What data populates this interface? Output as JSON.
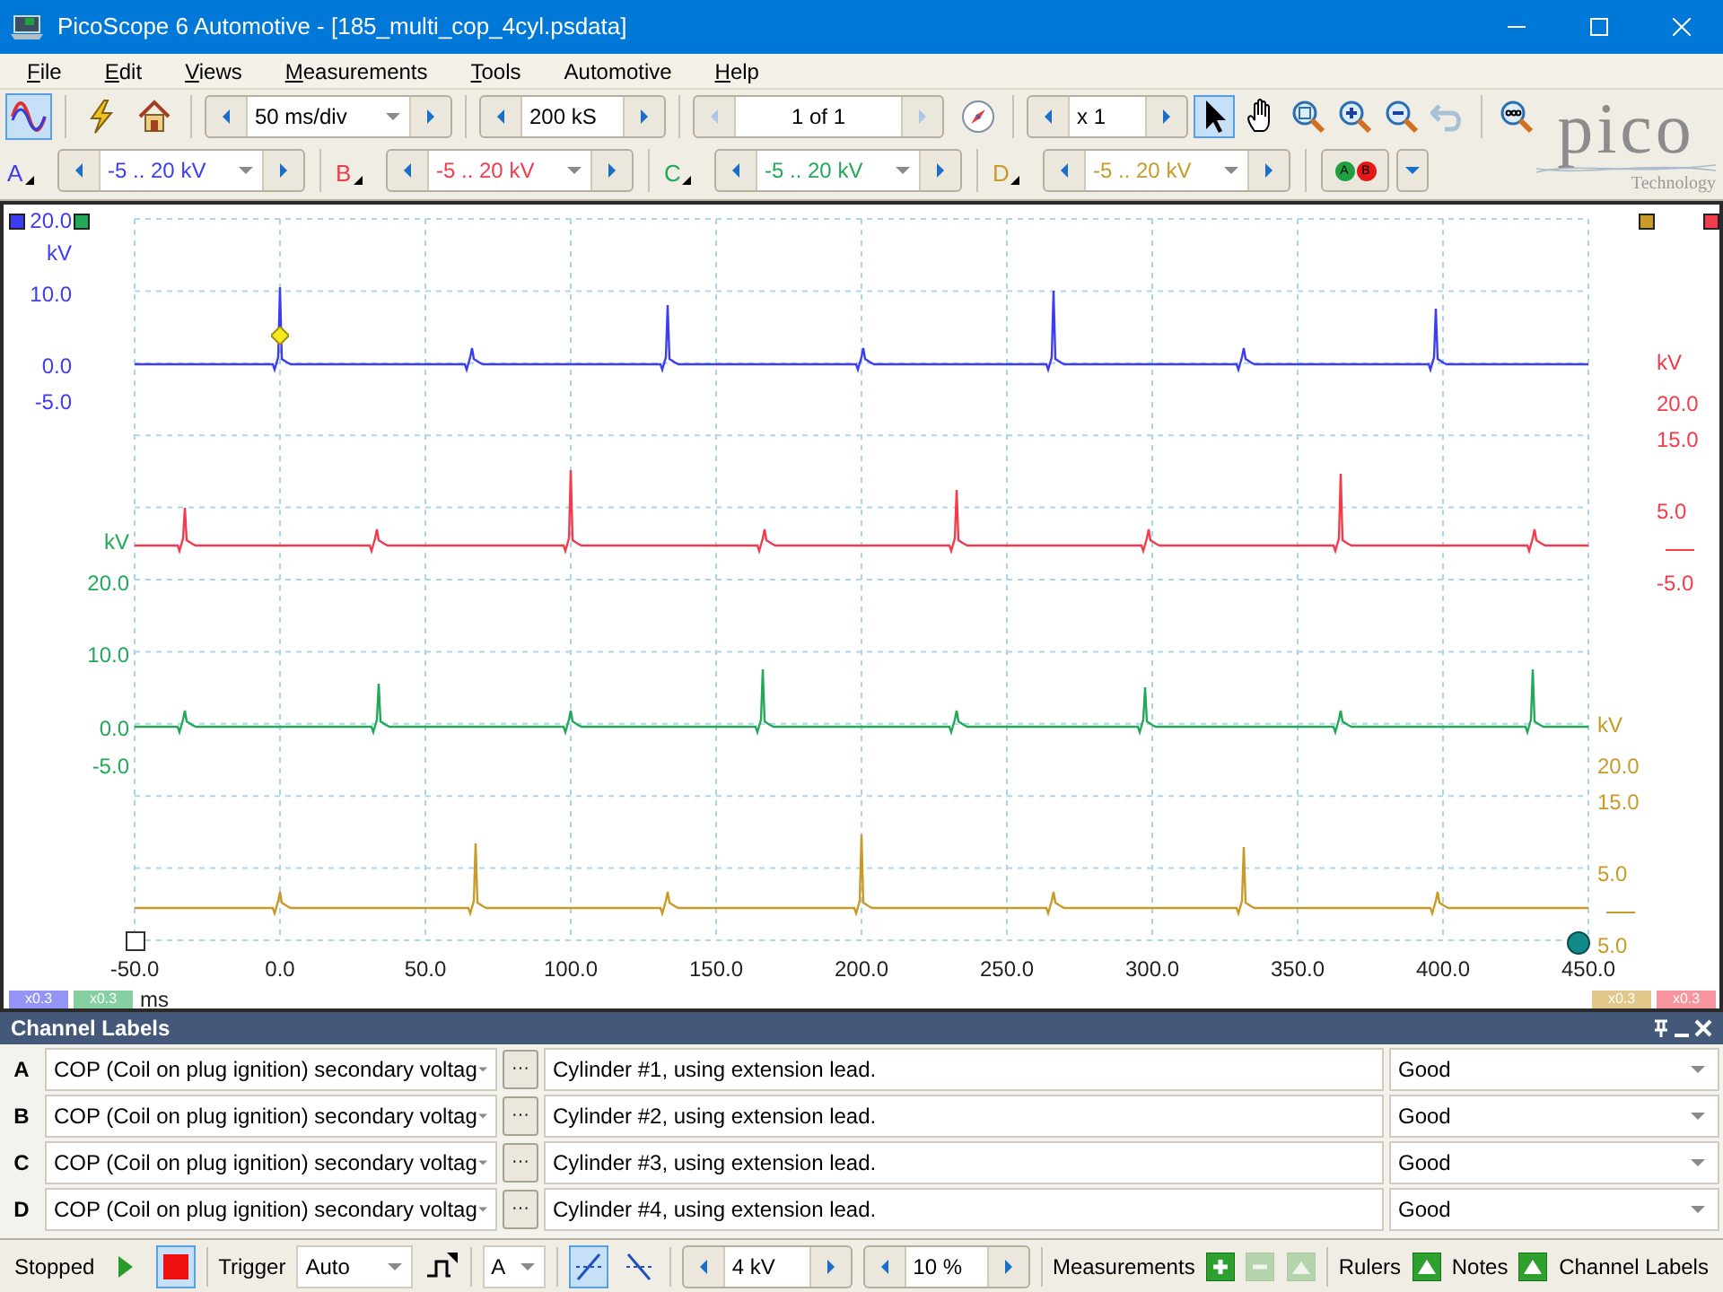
{
  "window": {
    "title": "PicoScope 6 Automotive - [185_multi_cop_4cyl.psdata]"
  },
  "menu": [
    {
      "label": "File",
      "mnemonic": true
    },
    {
      "label": "Edit",
      "mnemonic": true
    },
    {
      "label": "Views",
      "mnemonic": true
    },
    {
      "label": "Measurements",
      "mnemonic": true
    },
    {
      "label": "Tools",
      "mnemonic": true
    },
    {
      "label": "Automotive",
      "mnemonic": false
    },
    {
      "label": "Help",
      "mnemonic": true
    }
  ],
  "toolbar": {
    "mode_buttons": [
      {
        "kind": "scope",
        "selected": true
      },
      {
        "kind": "auto-setup",
        "selected": false
      },
      {
        "kind": "home",
        "selected": false
      }
    ],
    "timebase": "50 ms/div",
    "samples": "200 kS",
    "buffer": {
      "value": "1 of 1",
      "disabled": true
    },
    "zoom": "x 1",
    "view_tools": [
      {
        "kind": "pointer",
        "selected": true,
        "disabled": false
      },
      {
        "kind": "hand",
        "selected": false,
        "disabled": false
      },
      {
        "kind": "zoom-window",
        "selected": false,
        "disabled": false
      },
      {
        "kind": "zoom-in",
        "selected": false,
        "disabled": false
      },
      {
        "kind": "zoom-out",
        "selected": false,
        "disabled": false
      },
      {
        "kind": "undo-zoom",
        "selected": false,
        "disabled": true
      },
      {
        "kind": "zoom-fit",
        "selected": false,
        "disabled": false
      }
    ]
  },
  "logo": {
    "wordmark": "pico",
    "tagline": "Technology"
  },
  "channels": [
    {
      "letter": "A",
      "range": "-5 .. 20 kV",
      "color": "#3c3cf0"
    },
    {
      "letter": "B",
      "range": "-5 .. 20 kV",
      "color": "#f03c4c"
    },
    {
      "letter": "C",
      "range": "-5 .. 20 kV",
      "color": "#22a858"
    },
    {
      "letter": "D",
      "range": "-5 .. 20 kV",
      "color": "#c89a28"
    }
  ],
  "channel_toggle": [
    {
      "letter": "A",
      "color": "#20a040"
    },
    {
      "letter": "B",
      "color": "#e01818"
    }
  ],
  "scope": {
    "axes": [
      {
        "labels": [
          "20.0",
          "kV",
          "10.0",
          "0.0",
          "-5.0"
        ]
      },
      {
        "labels": [
          "kV",
          "20.0",
          "10.0",
          "0.0",
          "-5.0"
        ]
      },
      {
        "labels": [
          "kV",
          "20.0",
          "15.0",
          "5.0",
          "-5.0"
        ]
      },
      {
        "labels": [
          "kV",
          "20.0",
          "15.0",
          "5.0",
          "5.0"
        ]
      }
    ],
    "x_axis": {
      "labels": [
        "-50.0",
        "0.0",
        "50.0",
        "100.0",
        "150.0",
        "200.0",
        "250.0",
        "300.0",
        "350.0",
        "400.0",
        "450.0"
      ],
      "unit": "ms"
    },
    "scale_chips": [
      {
        "text": "x0.3"
      },
      {
        "text": "x0.3"
      },
      {
        "text": "x0.3"
      },
      {
        "text": "x0.3"
      }
    ]
  },
  "channel_labels": {
    "title": "Channel Labels",
    "rows": [
      {
        "letter": "A",
        "label": "COP (Coil on plug ignition) secondary voltag",
        "more": "···",
        "description": "Cylinder #1, using extension lead.",
        "status": "Good"
      },
      {
        "letter": "B",
        "label": "COP (Coil on plug ignition) secondary voltag",
        "more": "···",
        "description": "Cylinder #2, using extension lead.",
        "status": "Good"
      },
      {
        "letter": "C",
        "label": "COP (Coil on plug ignition) secondary voltag",
        "more": "···",
        "description": "Cylinder #3, using extension lead.",
        "status": "Good"
      },
      {
        "letter": "D",
        "label": "COP (Coil on plug ignition) secondary voltag",
        "more": "···",
        "description": "Cylinder #4, using extension lead.",
        "status": "Good"
      }
    ]
  },
  "status_bar": {
    "state": "Stopped",
    "running": false,
    "trigger_label": "Trigger",
    "trigger_mode": "Auto",
    "trigger_source": "A",
    "edge_buttons": [
      {
        "kind": "rising",
        "selected": true
      },
      {
        "kind": "falling",
        "selected": false
      }
    ],
    "threshold": "4 kV",
    "pre_trigger": "10 %",
    "measurements_label": "Measurements",
    "measure_buttons": [
      {
        "kind": "add",
        "disabled": false
      },
      {
        "kind": "remove",
        "disabled": true
      },
      {
        "kind": "edit",
        "disabled": true
      }
    ],
    "rulers_label": "Rulers",
    "notes_label": "Notes",
    "channel_labels_label": "Channel Labels"
  }
}
